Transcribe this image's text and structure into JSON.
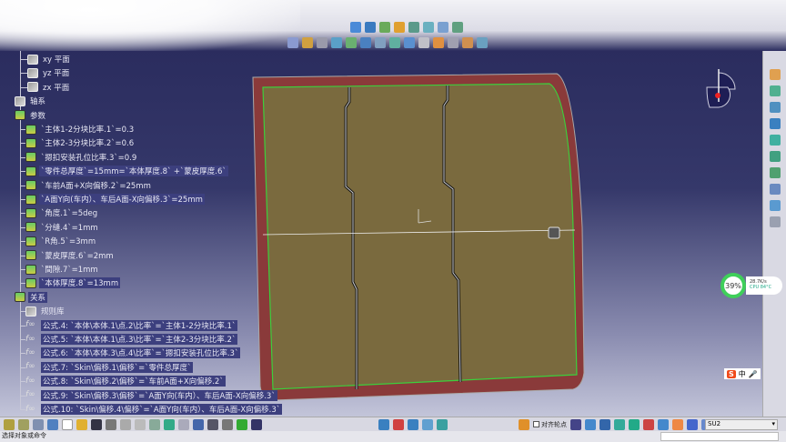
{
  "tree": {
    "planes": [
      "xy 平面",
      "yz 平面",
      "zx 平面"
    ],
    "axis_system": "轴系",
    "parameters_label": "参数",
    "parameters": [
      "`主体1-2分块比率.1`=0.3",
      "`主体2-3分块比率.2`=0.6",
      "`摁扣安装孔位比率.3`=0.9",
      "`零件总厚度`=15mm=`本体厚度.8` +`蒙皮厚度.6`",
      "`车前A面+X向偏移.2`=25mm",
      "`A面Y向(车内）、车后A面-X向偏移.3`=25mm",
      "`角度.1`=5deg",
      "`分缝.4`=1mm",
      "`R角.5`=3mm",
      "`蒙皮厚度.6`=2mm",
      "`間隙.7`=1mm",
      "`本体厚度.8`=13mm"
    ],
    "relations_label": "关系",
    "rules_label": "规则库",
    "formulas": [
      "公式.4: `本体\\本体.1\\点.2\\比率`=`主体1-2分块比率.1`",
      "公式.5: `本体\\本体.1\\点.3\\比率`=`主体2-3分块比率.2`",
      "公式.6: `本体\\本体.3\\点.4\\比率`=`摁扣安装孔位比率.3`",
      "公式.7: `Skin\\偏移.1\\偏移`=`零件总厚度`",
      "公式.8: `Skin\\偏移.2\\偏移`=`车前A面+X向偏移.2`",
      "公式.9: `Skin\\偏移.3\\偏移`=`A面Y向(车内）、车后A面-X向偏移.3`",
      "公式.10: `Skin\\偏移.4\\偏移`=`A面Y向(车内）、车后A面-X向偏移.3`"
    ]
  },
  "toolbar": {
    "snap_point_label": "对齐轮点",
    "layer_value": "SU2"
  },
  "status": {
    "message": "选择对象或命令"
  },
  "monitor": {
    "cpu_percent": "39%",
    "net": "28.7K/s",
    "cpu_temp": "CPU 84°C"
  },
  "ime": {
    "logo": "S",
    "mode": "中"
  },
  "colors": {
    "panel_fill": "#7a6a3e",
    "panel_edge": "#8a3a3a",
    "panel_border": "#3ccf3c",
    "background_top": "#27285a",
    "background_bottom": "#c4c6da"
  }
}
